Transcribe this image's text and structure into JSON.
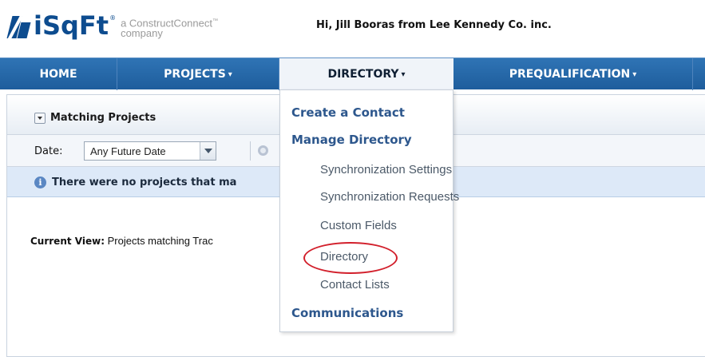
{
  "header": {
    "logo_text": "iSqFt",
    "logo_tm": "®",
    "tagline_line1": "a ConstructConnect",
    "tagline_tm": "™",
    "tagline_line2": "company",
    "greeting": "Hi, Jill Booras from Lee Kennedy Co. inc."
  },
  "nav": {
    "items": [
      {
        "label": "HOME",
        "caret": ""
      },
      {
        "label": "PROJECTS",
        "caret": "▾"
      },
      {
        "label": "DIRECTORY",
        "caret": "▾"
      },
      {
        "label": "PREQUALIFICATION",
        "caret": "▾"
      }
    ],
    "active": "DIRECTORY"
  },
  "panel": {
    "title": "Matching Projects",
    "date_label": "Date:",
    "date_value": "Any Future Date",
    "info_message": "There were no projects that ma",
    "current_view_label": "Current View:",
    "current_view_value": " Projects matching Trac"
  },
  "dropdown": {
    "headings": [
      "Create a Contact",
      "Manage Directory",
      "Communications"
    ],
    "sub_items": [
      "Synchronization Settings",
      "Synchronization Requests",
      "Custom Fields",
      "Directory",
      "Contact Lists"
    ],
    "highlighted": "Directory"
  },
  "colors": {
    "nav_blue": "#1e5d9c",
    "menu_heading": "#2d578d",
    "highlight_red": "#d21f2b",
    "info_bg": "#dde9f8"
  }
}
